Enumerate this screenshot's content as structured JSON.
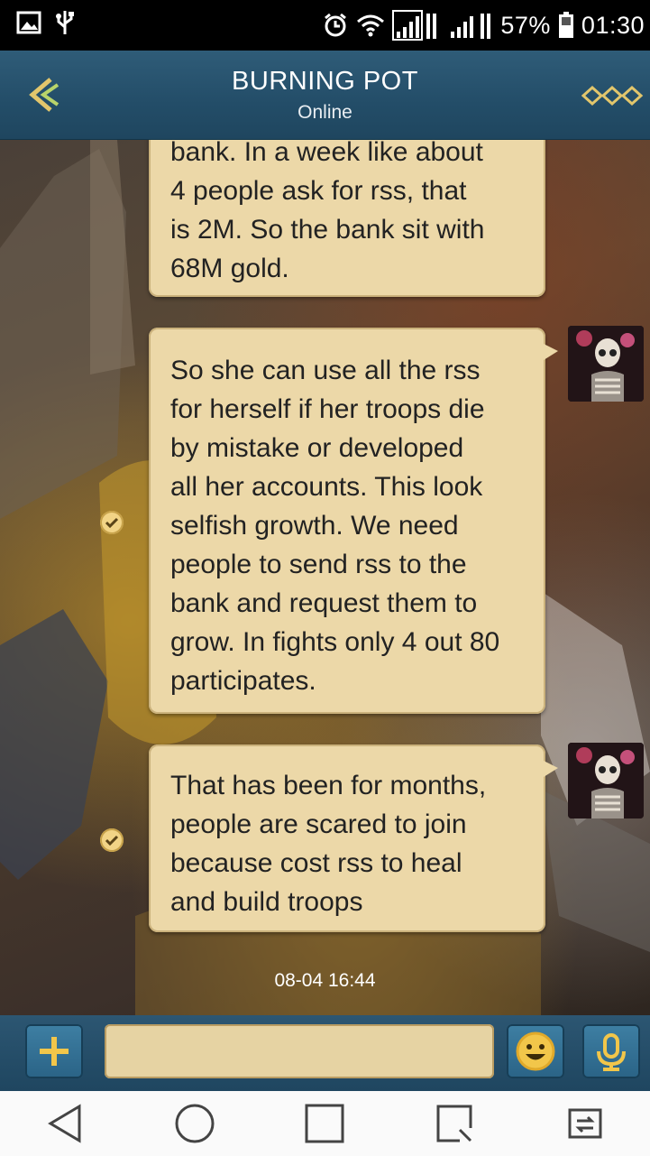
{
  "status_bar": {
    "battery_percent": "57%",
    "time": "01:30",
    "icons": [
      "image-notification-icon",
      "usb-icon",
      "alarm-icon",
      "wifi-icon",
      "signal-icon",
      "signal-icon",
      "battery-icon"
    ]
  },
  "header": {
    "title": "BURNING POT",
    "subtitle": "Online",
    "back_icon": "chevron-left-icon",
    "menu_icon": "diamonds-menu-icon"
  },
  "messages": [
    {
      "lines": [
        "bank. In a week like about",
        "4 people ask for rss, that",
        "is 2M. So the bank sit with",
        "68M gold."
      ]
    },
    {
      "lines": [
        "So she can use all the rss",
        "for herself if her troops die",
        "by mistake or developed",
        "all her accounts. This look",
        "selfish growth. We need",
        "people to send rss to the",
        "bank and request them to",
        "grow. In fights only 4 out 80",
        "participates."
      ]
    },
    {
      "lines": [
        "That has been for months,",
        "people are scared to join",
        "because cost rss to heal",
        "and build troops"
      ]
    }
  ],
  "timestamp": "08-04 16:44",
  "input_bar": {
    "add_icon": "plus-icon",
    "input_value": "",
    "emoji_icon": "smiley-icon",
    "mic_icon": "microphone-icon"
  },
  "colors": {
    "header_bg": "#234d68",
    "bubble_bg": "#ecd8a8",
    "button_bg": "#2a6386",
    "accent_gold": "#f2c64a"
  }
}
